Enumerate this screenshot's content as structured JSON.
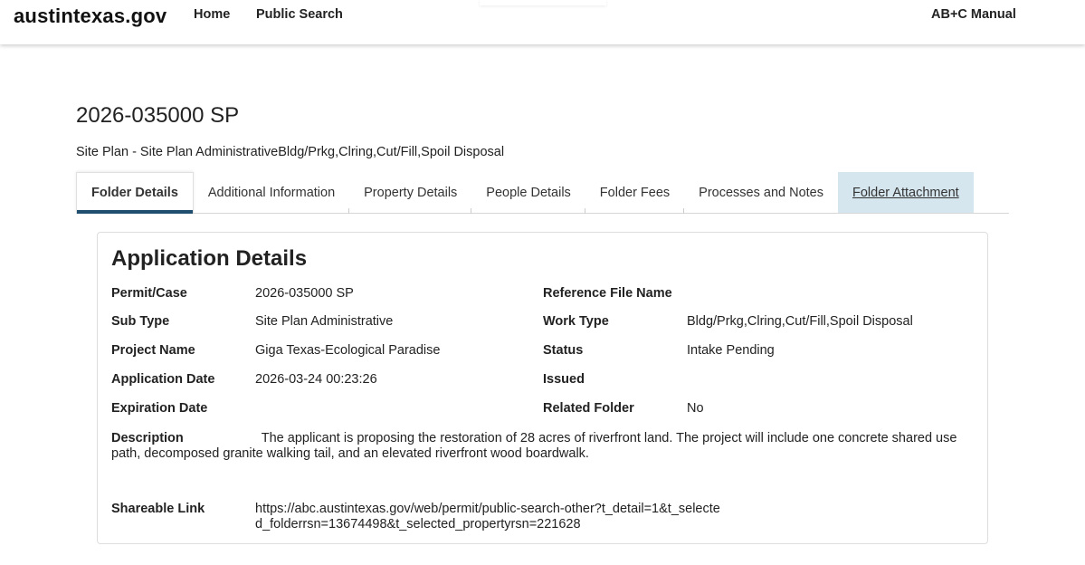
{
  "header": {
    "logo": "austintexas.gov",
    "nav": {
      "home": "Home",
      "public_search": "Public Search",
      "manual": "AB+C Manual"
    }
  },
  "folder": {
    "number": "2026-035000 SP",
    "subtitle": "Site Plan - Site Plan AdministrativeBldg/Prkg,Clring,Cut/Fill,Spoil Disposal"
  },
  "tabs": [
    {
      "label": "Folder Details"
    },
    {
      "label": "Additional Information"
    },
    {
      "label": "Property Details"
    },
    {
      "label": "People Details"
    },
    {
      "label": "Folder Fees"
    },
    {
      "label": "Processes and Notes"
    },
    {
      "label": "Folder Attachment"
    }
  ],
  "details": {
    "title": "Application Details",
    "permit_label": "Permit/Case",
    "permit_value": "2026-035000 SP",
    "subtype_label": "Sub Type",
    "subtype_value": "Site Plan Administrative",
    "project_label": "Project Name",
    "project_value": "Giga Texas-Ecological Paradise",
    "appdate_label": "Application Date",
    "appdate_value": "2026-03-24 00:23:26",
    "expdate_label": "Expiration Date",
    "ref_label": "Reference File Name",
    "worktype_label": "Work Type",
    "worktype_value": "Bldg/Prkg,Clring,Cut/Fill,Spoil Disposal",
    "status_label": "Status",
    "status_value": "Intake Pending",
    "issued_label": "Issued",
    "related_label": "Related Folder",
    "related_value": "No",
    "description_label": "Description",
    "description_value": "The applicant is proposing the restoration of 28 acres of riverfront land. The project will include one concrete shared use path, decomposed granite walking tail, and an elevated riverfront wood boardwalk.",
    "link_label": "Shareable Link",
    "link_value": "https://abc.austintexas.gov/web/permit/public-search-other?t_detail=1&t_selected_folderrsn=13674498&t_selected_propertyrsn=221628"
  },
  "colors": {
    "accent": "#1f4e6e",
    "highlight_tab": "#d6e6ef"
  }
}
